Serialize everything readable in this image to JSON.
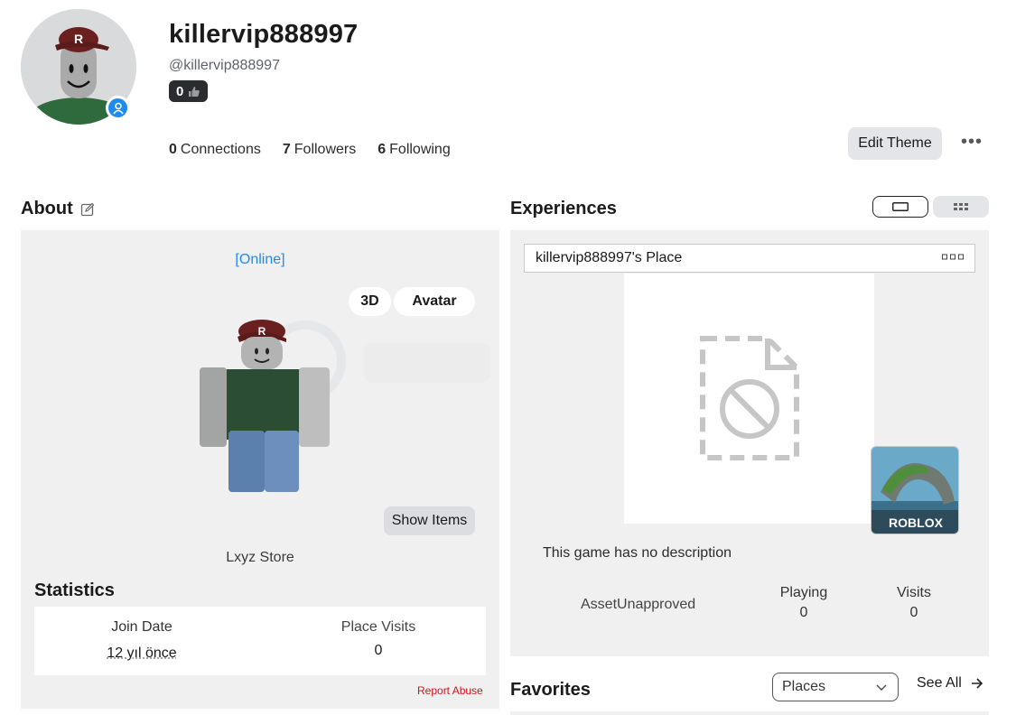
{
  "profile": {
    "username": "killervip888997",
    "handle": "@killervip888997",
    "reputation": "0",
    "connections_count": "0",
    "connections_label": "Connections",
    "followers_count": "7",
    "followers_label": "Followers",
    "following_count": "6",
    "following_label": "Following",
    "edit_theme_label": "Edit Theme",
    "more_label": "•••",
    "accent_color": "#1f8bef"
  },
  "about": {
    "title": "About",
    "status": "[Online]",
    "btn_3d": "3D",
    "btn_avatar": "Avatar",
    "show_items": "Show Items",
    "store_name": "Lxyz Store",
    "statistics_title": "Statistics",
    "join_date_label": "Join Date",
    "join_date_value": "12 yıl önce",
    "place_visits_label": "Place Visits",
    "place_visits_value": "0",
    "report_abuse": "Report Abuse"
  },
  "experiences": {
    "title": "Experiences",
    "place_name": "killervip888997's Place",
    "icon_text": "ROBLOX",
    "description": "This game has no description",
    "asset_status": "AssetUnapproved",
    "playing_label": "Playing",
    "playing_value": "0",
    "visits_label": "Visits",
    "visits_value": "0"
  },
  "favorites": {
    "title": "Favorites",
    "select_value": "Places",
    "see_all": "See All"
  }
}
